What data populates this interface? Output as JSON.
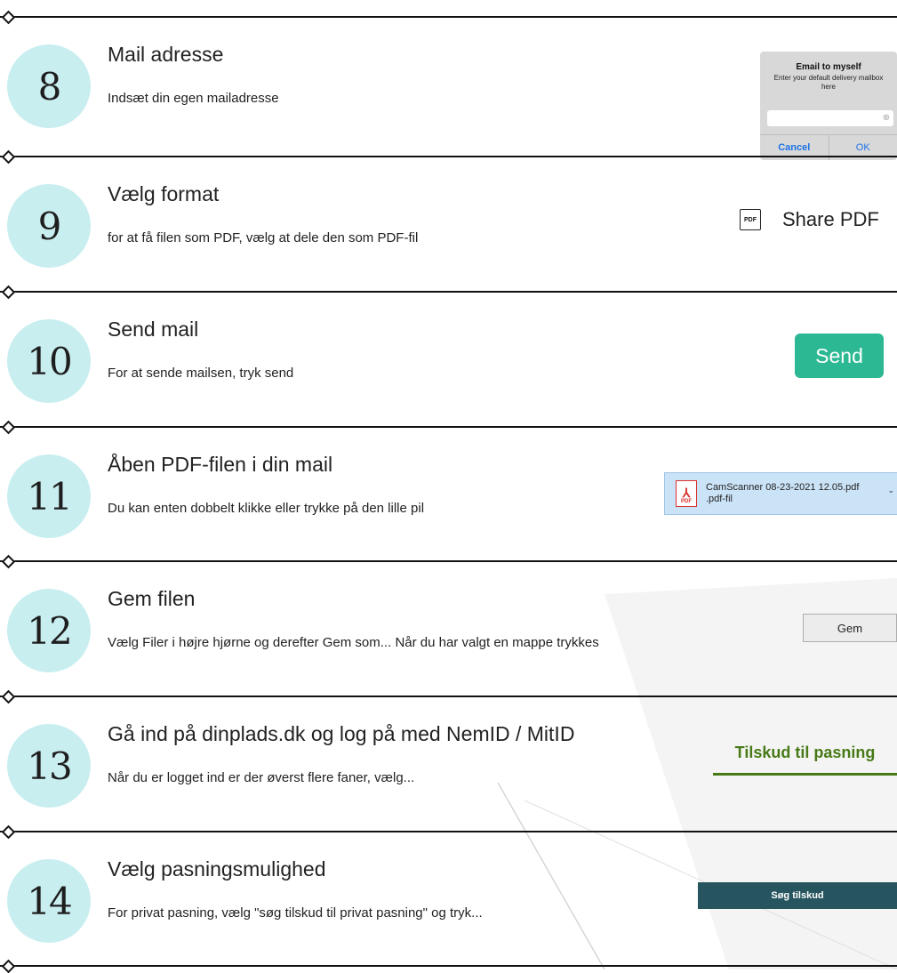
{
  "steps": [
    {
      "number": "8",
      "title": "Mail adresse",
      "description": "Indsæt din egen mailadresse"
    },
    {
      "number": "9",
      "title": "Vælg format",
      "description": "for at få filen som PDF, vælg at dele den som PDF-fil"
    },
    {
      "number": "10",
      "title": "Send mail",
      "description": "For at sende mailsen, tryk send"
    },
    {
      "number": "11",
      "title": "Åben PDF-filen i din mail",
      "description": "Du kan enten dobbelt klikke eller trykke på den lille pil"
    },
    {
      "number": "12",
      "title": "Gem filen",
      "description": "Vælg Filer i højre hjørne og derefter Gem som... Når du har valgt en mappe trykkes"
    },
    {
      "number": "13",
      "title": "Gå ind på dinplads.dk og log på med NemID / MitID",
      "description": "Når du er logget ind er der øverst flere faner, vælg..."
    },
    {
      "number": "14",
      "title": "Vælg pasningsmulighed",
      "description": "For privat pasning, vælg \"søg tilskud til privat pasning\" og tryk..."
    }
  ],
  "email_dialog": {
    "title": "Email to myself",
    "subtitle": "Enter your default delivery mailbox here",
    "cancel_label": "Cancel",
    "ok_label": "OK"
  },
  "share_pdf": {
    "icon_text": "PDF",
    "label": "Share PDF"
  },
  "send_button": {
    "label": "Send",
    "color": "#2bb893"
  },
  "file_chip": {
    "filename": "CamScanner 08-23-2021 12.05.pdf",
    "filetype": ".pdf-fil",
    "icon_text": "PDF"
  },
  "gem_button": {
    "label": "Gem"
  },
  "tilskud_tab": {
    "label": "Tilskud til pasning",
    "color": "#477a16"
  },
  "sog_button": {
    "label": "Søg tilskud",
    "color": "#26555f"
  },
  "accent_circle_color": "#c9eef0"
}
